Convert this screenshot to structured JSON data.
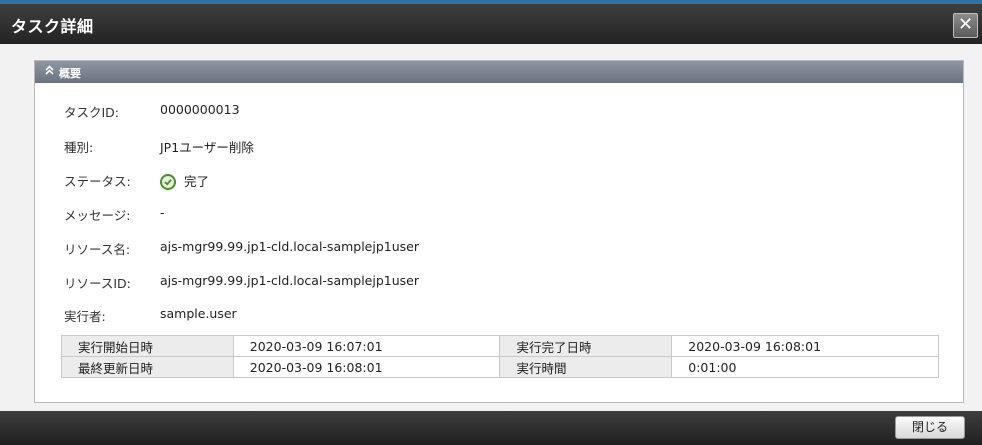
{
  "dialog": {
    "title": "タスク詳細",
    "close_icon": "✕"
  },
  "section": {
    "collapse_icon": "chevron-double-up-icon",
    "title": "概要"
  },
  "details": [
    {
      "label": "タスクID:",
      "value": "0000000013"
    },
    {
      "label": "種別:",
      "value": "JP1ユーザー削除"
    },
    {
      "label": "ステータス:",
      "value": "完了",
      "icon": "check-circle-icon",
      "status_color": "#4b8f2b"
    },
    {
      "label": "メッセージ:",
      "value": "-"
    },
    {
      "label": "リソース名:",
      "value": "ajs-mgr99.99.jp1-cld.local-samplejp1user"
    },
    {
      "label": "リソースID:",
      "value": "ajs-mgr99.99.jp1-cld.local-samplejp1user"
    },
    {
      "label": "実行者:",
      "value": "sample.user"
    }
  ],
  "times": [
    [
      {
        "header": "実行開始日時",
        "value": "2020-03-09 16:07:01"
      },
      {
        "header": "実行完了日時",
        "value": "2020-03-09 16:08:01"
      }
    ],
    [
      {
        "header": "最終更新日時",
        "value": "2020-03-09 16:08:01"
      },
      {
        "header": "実行時間",
        "value": "0:01:00"
      }
    ]
  ],
  "footer": {
    "close_label": "閉じる"
  }
}
